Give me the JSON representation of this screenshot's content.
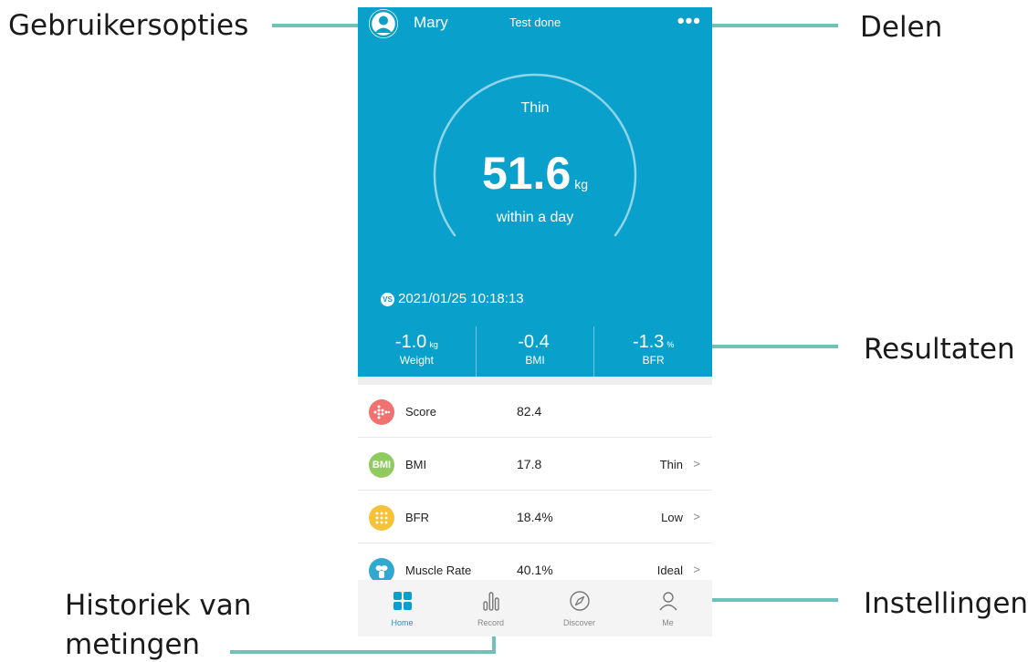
{
  "header": {
    "user_name": "Mary",
    "status": "Test done",
    "more": "•••"
  },
  "measurement": {
    "body_type": "Thin",
    "weight_value": "51.6",
    "weight_unit": "kg",
    "note": "within a day"
  },
  "comparison": {
    "badge": "VS",
    "datetime": "2021/01/25 10:18:13",
    "items": [
      {
        "value": "-1.0",
        "unit": "kg",
        "label": "Weight"
      },
      {
        "value": "-0.4",
        "unit": "",
        "label": "BMI"
      },
      {
        "value": "-1.3",
        "unit": "%",
        "label": "BFR"
      }
    ]
  },
  "metrics": [
    {
      "label": "Score",
      "value": "82.4",
      "level": "",
      "chevron": "",
      "icon": "score-icon",
      "icon_text": "",
      "color": "#f17070"
    },
    {
      "label": "BMI",
      "value": "17.8",
      "level": "Thin",
      "chevron": ">",
      "icon": "bmi-icon",
      "icon_text": "BMI",
      "color": "#8fcb5e"
    },
    {
      "label": "BFR",
      "value": "18.4%",
      "level": "Low",
      "chevron": ">",
      "icon": "bfr-icon",
      "icon_text": "",
      "color": "#f5c23a"
    },
    {
      "label": "Muscle Rate",
      "value": "40.1%",
      "level": "Ideal",
      "chevron": ">",
      "icon": "muscle-icon",
      "icon_text": "",
      "color": "#2fa9cf"
    }
  ],
  "tabs": [
    {
      "label": "Home",
      "icon": "home-grid-icon",
      "active": true
    },
    {
      "label": "Record",
      "icon": "bar-chart-icon",
      "active": false
    },
    {
      "label": "Discover",
      "icon": "compass-icon",
      "active": false
    },
    {
      "label": "Me",
      "icon": "person-icon",
      "active": false
    }
  ],
  "annotations": {
    "user_options": "Gebruikersopties",
    "share": "Delen",
    "results": "Resultaten",
    "history_line1": "Historiek van",
    "history_line2": "metingen",
    "settings": "Instellingen"
  },
  "colors": {
    "primary": "#0aa0cc",
    "leader": "#6fc2b7"
  }
}
